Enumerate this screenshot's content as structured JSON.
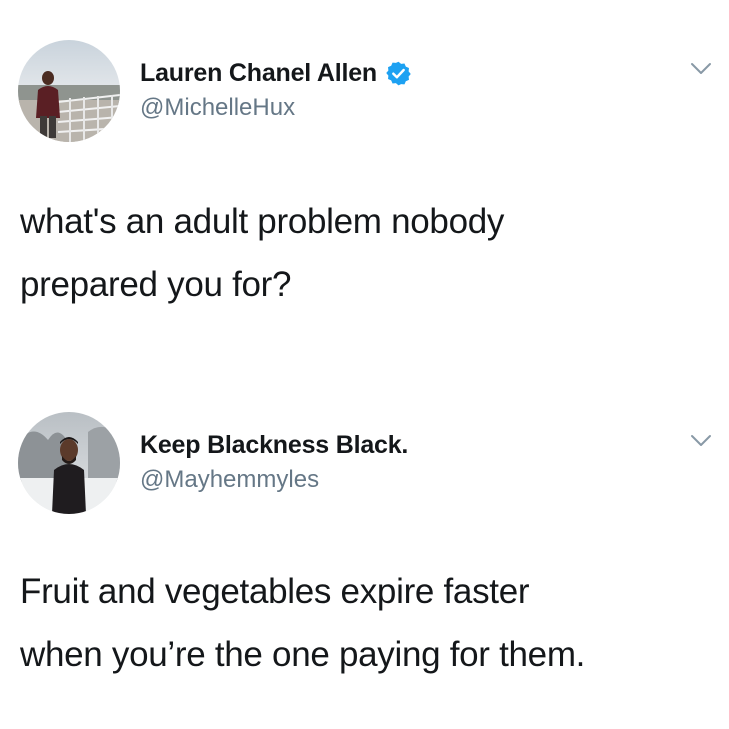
{
  "colors": {
    "text": "#14171a",
    "secondary": "#657786",
    "verified_blue": "#1da1f2",
    "background": "#ffffff"
  },
  "tweets": [
    {
      "display_name": "Lauren Chanel Allen",
      "handle": "@MichelleHux",
      "verified": true,
      "avatar_icon": "user-avatar-photo",
      "menu_icon": "chevron-down-icon",
      "text_lines": [
        "what's an adult problem nobody",
        "prepared you for?"
      ]
    },
    {
      "display_name": "Keep Blackness Black.",
      "handle": "@Mayhemmyles",
      "verified": false,
      "avatar_icon": "user-avatar-photo",
      "menu_icon": "chevron-down-icon",
      "text_lines": [
        "Fruit and vegetables expire faster",
        "when you’re the one paying for them."
      ]
    }
  ]
}
